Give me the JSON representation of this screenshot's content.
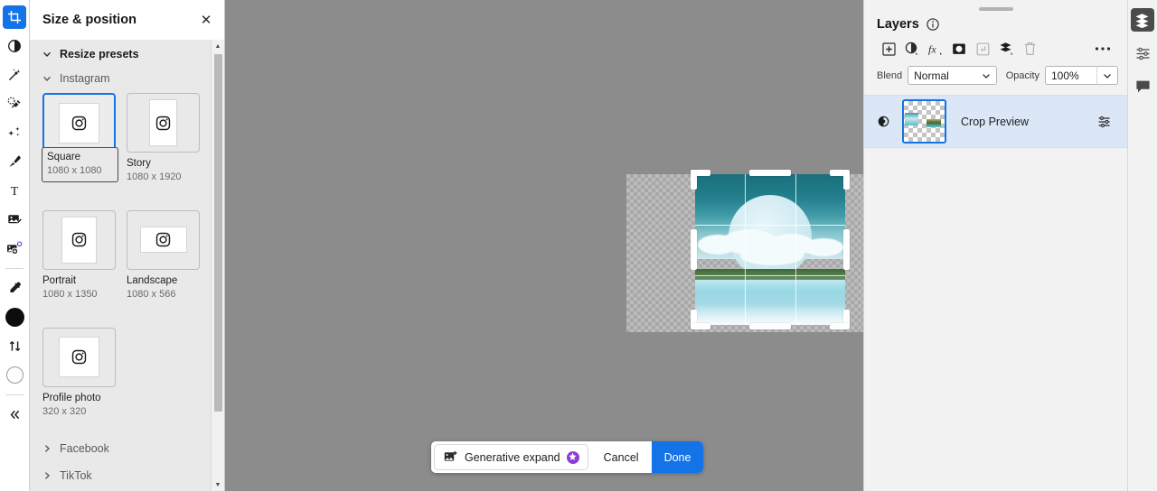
{
  "toolbar_left": {
    "tools": [
      {
        "name": "crop-tool",
        "icon": "crop-icon",
        "active": true
      },
      {
        "name": "adjustment-tool",
        "icon": "contrast-circle-icon",
        "active": false
      },
      {
        "name": "magic-wand-tool",
        "icon": "magic-wand-icon",
        "active": false
      },
      {
        "name": "healing-brush-tool",
        "icon": "healing-brush-icon",
        "active": false
      },
      {
        "name": "effects-tool",
        "icon": "sparkles-icon",
        "active": false
      },
      {
        "name": "brush-tool",
        "icon": "paintbrush-icon",
        "active": false
      },
      {
        "name": "text-tool",
        "icon": "text-t-icon",
        "active": false
      },
      {
        "name": "image-edit-tool",
        "icon": "image-pencil-icon",
        "active": false
      },
      {
        "name": "add-image-tool",
        "icon": "add-image-icon",
        "active": false
      },
      {
        "name": "eyedropper-tool",
        "icon": "eyedropper-icon",
        "active": false
      },
      {
        "name": "foreground-color-swatch",
        "icon": "filled-circle-icon",
        "active": false
      },
      {
        "name": "swap-colors",
        "icon": "swap-arrows-icon",
        "active": false
      },
      {
        "name": "background-color-swatch",
        "icon": "outline-circle-icon",
        "active": false
      },
      {
        "name": "collapse-rail",
        "icon": "double-chevron-left-icon",
        "active": false
      }
    ]
  },
  "size_panel": {
    "title": "Size & position",
    "close_label": "✕",
    "sections": [
      {
        "label": "Resize presets",
        "expanded": true,
        "strong": true
      },
      {
        "label": "Instagram",
        "expanded": true,
        "strong": false
      }
    ],
    "presets": [
      {
        "name": "Square",
        "dimensions": "1080 x 1080",
        "shape": "square",
        "selected": true
      },
      {
        "name": "Story",
        "dimensions": "1080 x 1920",
        "shape": "tall",
        "selected": false
      },
      {
        "name": "Portrait",
        "dimensions": "1080 x 1350",
        "shape": "portrait",
        "selected": false
      },
      {
        "name": "Landscape",
        "dimensions": "1080 x 566",
        "shape": "wide",
        "selected": false
      },
      {
        "name": "Profile photo",
        "dimensions": "320 x 320",
        "shape": "square",
        "selected": false
      }
    ],
    "more_sections": [
      {
        "label": "Facebook",
        "expanded": false
      },
      {
        "label": "TikTok",
        "expanded": false
      }
    ]
  },
  "action_bar": {
    "generative_expand": "Generative expand",
    "cancel": "Cancel",
    "done": "Done"
  },
  "layers_panel": {
    "title": "Layers",
    "info_icon": "info-circle-icon",
    "tools": [
      {
        "name": "add-layer-button",
        "icon": "plus-square-icon",
        "enabled": true
      },
      {
        "name": "adjustment-layer-button",
        "icon": "half-circle-icon",
        "enabled": true
      },
      {
        "name": "layer-effects-button",
        "icon": "fx-icon",
        "enabled": true
      },
      {
        "name": "layer-mask-button",
        "icon": "mask-icon",
        "enabled": true
      },
      {
        "name": "clipping-mask-button",
        "icon": "clip-arrow-icon",
        "enabled": false
      },
      {
        "name": "group-layers-button",
        "icon": "stack-icon",
        "enabled": true
      },
      {
        "name": "delete-layer-button",
        "icon": "trash-icon",
        "enabled": false
      },
      {
        "name": "layer-more-options-button",
        "icon": "ellipsis-icon",
        "enabled": true
      }
    ],
    "blend_label": "Blend",
    "blend_value": "Normal",
    "opacity_label": "Opacity",
    "opacity_value": "100%",
    "layers": [
      {
        "name": "Crop Preview",
        "visible": true,
        "selected": true
      }
    ]
  },
  "right_rail": {
    "tools": [
      {
        "name": "layers-panel-toggle",
        "icon": "layers-stack-icon",
        "active": true
      },
      {
        "name": "properties-panel-toggle",
        "icon": "sliders-icon",
        "active": false
      },
      {
        "name": "comments-panel-toggle",
        "icon": "comment-bubble-icon",
        "active": false
      }
    ]
  },
  "canvas": {
    "artboard_label": "transparent-artboard",
    "crop_selection_label": "crop-selection"
  },
  "colors": {
    "accent": "#1473e6",
    "panel_bg": "#e9e9e9",
    "canvas_bg": "#8c8c8c",
    "layer_selected": "#dbe7f6",
    "sparkle_purple": "#8b3bd6"
  }
}
